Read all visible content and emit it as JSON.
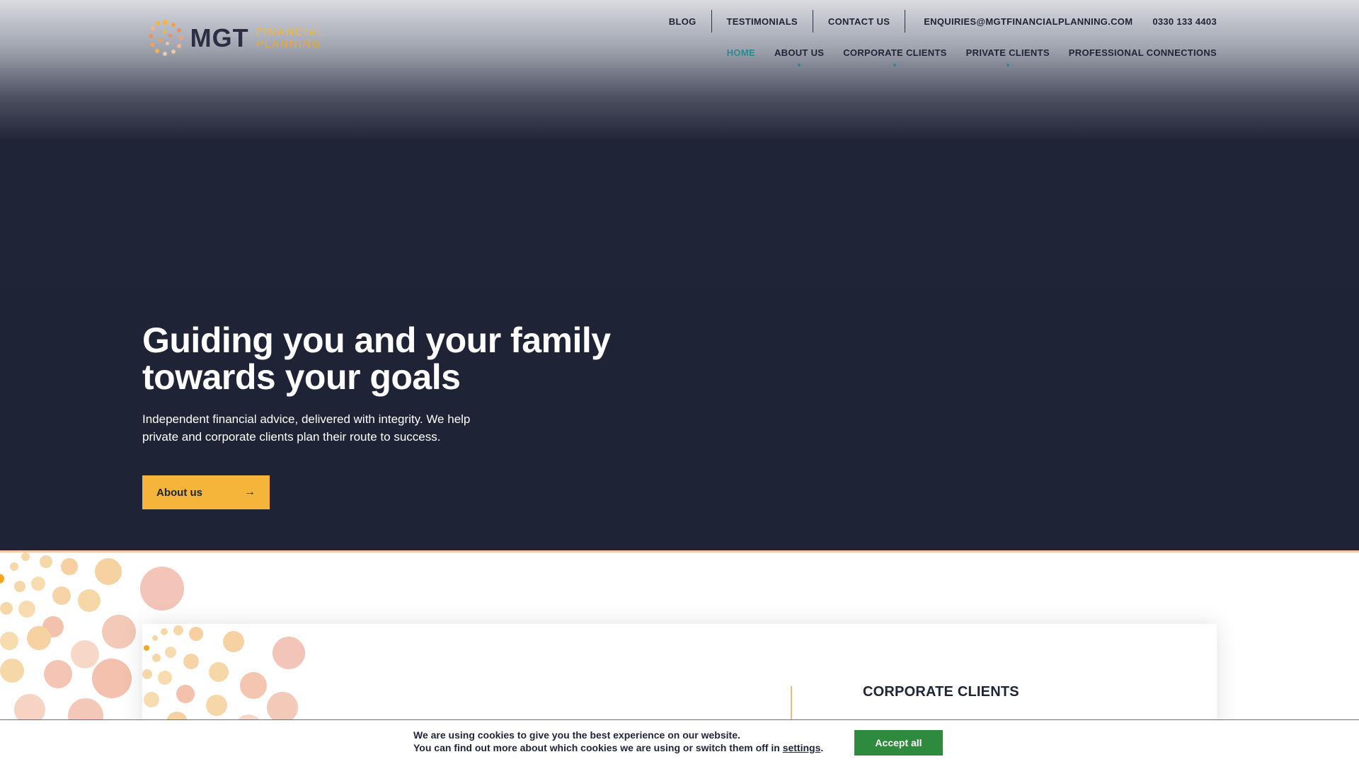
{
  "brand": {
    "name": "MGT",
    "sub_line1": "FINANCIAL",
    "sub_line2": "PLANNING",
    "colors": {
      "navy": "#1f2436",
      "orange": "#f5b53b",
      "teal": "#2a8a92",
      "green": "#2e8b3d"
    }
  },
  "top_nav": {
    "blog": "BLOG",
    "testimonials": "TESTIMONIALS",
    "contact": "CONTACT US",
    "email": "ENQUIRIES@MGTFINANCIALPLANNING.COM",
    "phone": "0330 133 4403"
  },
  "main_nav": {
    "home": "HOME",
    "about": "ABOUT US",
    "corporate": "CORPORATE CLIENTS",
    "private": "PRIVATE CLIENTS",
    "professional": "PROFESSIONAL CONNECTIONS"
  },
  "hero": {
    "title_line1": "Guiding you and your family",
    "title_line2": "towards your goals",
    "text_line1": "Independent financial advice, delivered with integrity. We help",
    "text_line2": "private and corporate clients plan their route to success.",
    "button_label": "About us",
    "button_icon": "arrow-right-icon"
  },
  "card": {
    "title": "CORPORATE CLIENTS"
  },
  "cookie": {
    "line1": "We are using cookies to give you the best experience on our website.",
    "line2_prefix": "You can find out more about which cookies we are using or switch them off in",
    "settings_link": "settings",
    "line2_suffix": ".",
    "accept_label": "Accept all"
  }
}
